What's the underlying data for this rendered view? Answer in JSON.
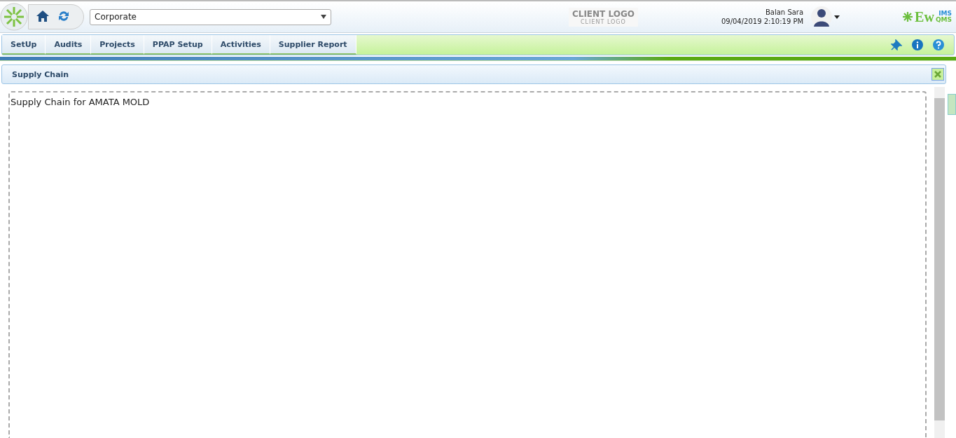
{
  "header": {
    "site_select": {
      "value": "Corporate"
    },
    "client_logo": {
      "title": "CLIENT LOGO",
      "subtitle": "CLIENT LOGO"
    },
    "user": {
      "name": "Balan Sara",
      "datetime": "09/04/2019 2:10:19 PM"
    },
    "brand": {
      "main": "Ew",
      "top": "IMS",
      "bottom": "QMS"
    }
  },
  "menu": [
    {
      "label": "SetUp"
    },
    {
      "label": "Audits"
    },
    {
      "label": "Projects"
    },
    {
      "label": "PPAP Setup"
    },
    {
      "label": "Activities"
    },
    {
      "label": "Supplier Report"
    }
  ],
  "panel": {
    "title": "Supply Chain",
    "content_title": "Supply Chain for AMATA MOLD"
  }
}
